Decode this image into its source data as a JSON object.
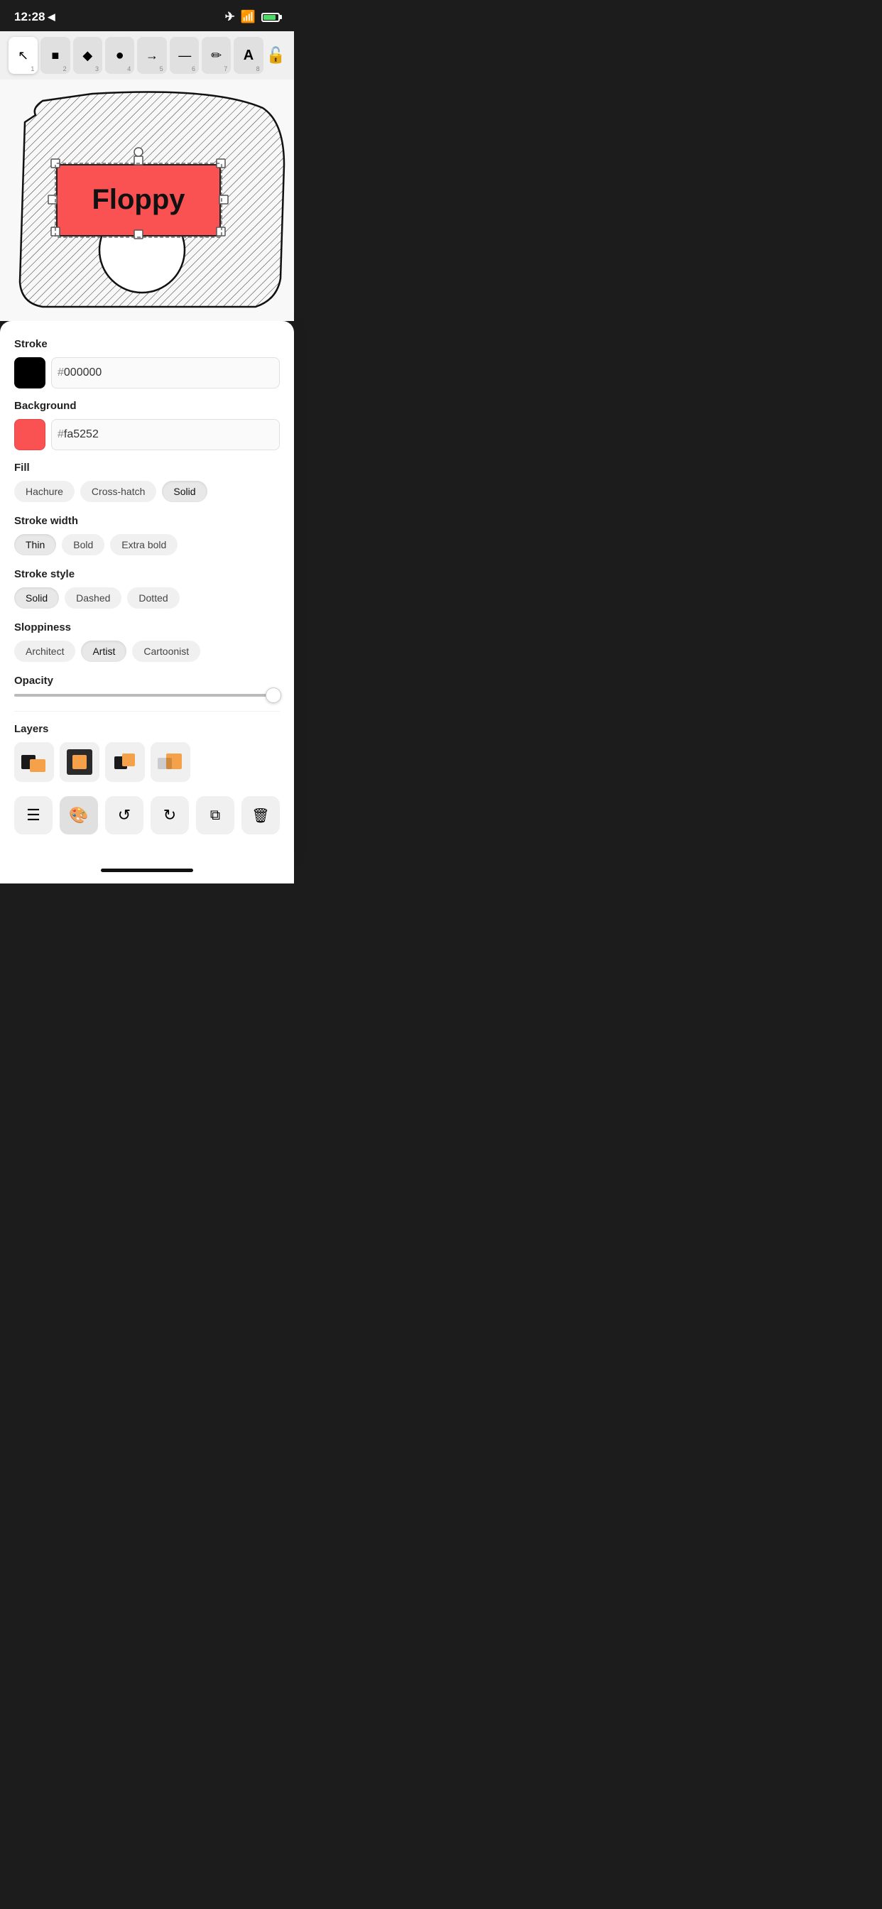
{
  "status": {
    "time": "12:28",
    "location_icon": "▶",
    "battery_level": 85
  },
  "toolbar": {
    "tools": [
      {
        "id": "select",
        "icon": "➤",
        "num": "1",
        "active": false
      },
      {
        "id": "rectangle",
        "icon": "■",
        "num": "2",
        "active": false
      },
      {
        "id": "diamond",
        "icon": "◆",
        "num": "3",
        "active": false
      },
      {
        "id": "ellipse",
        "icon": "●",
        "num": "4",
        "active": false
      },
      {
        "id": "arrow",
        "icon": "→",
        "num": "5",
        "active": false
      },
      {
        "id": "line",
        "icon": "—",
        "num": "6",
        "active": false
      },
      {
        "id": "pencil",
        "icon": "✏",
        "num": "7",
        "active": false
      },
      {
        "id": "text",
        "icon": "A",
        "num": "8",
        "active": false
      }
    ],
    "lock_icon": "🔓"
  },
  "canvas": {
    "label": "canvas-drawing"
  },
  "properties": {
    "stroke_label": "Stroke",
    "stroke_color": "#000000",
    "stroke_hex": "000000",
    "background_label": "Background",
    "bg_color": "#fa5252",
    "bg_hex": "fa5252",
    "fill_label": "Fill",
    "fill_options": [
      {
        "id": "hachure",
        "label": "Hachure",
        "active": false
      },
      {
        "id": "cross-hatch",
        "label": "Cross-hatch",
        "active": false
      },
      {
        "id": "solid",
        "label": "Solid",
        "active": true
      }
    ],
    "stroke_width_label": "Stroke width",
    "stroke_width_options": [
      {
        "id": "thin",
        "label": "Thin",
        "active": true
      },
      {
        "id": "bold",
        "label": "Bold",
        "active": false
      },
      {
        "id": "extra-bold",
        "label": "Extra bold",
        "active": false
      }
    ],
    "stroke_style_label": "Stroke style",
    "stroke_style_options": [
      {
        "id": "solid",
        "label": "Solid",
        "active": true
      },
      {
        "id": "dashed",
        "label": "Dashed",
        "active": false
      },
      {
        "id": "dotted",
        "label": "Dotted",
        "active": false
      }
    ],
    "sloppiness_label": "Sloppiness",
    "sloppiness_options": [
      {
        "id": "architect",
        "label": "Architect",
        "active": false
      },
      {
        "id": "artist",
        "label": "Artist",
        "active": true
      },
      {
        "id": "cartoonist",
        "label": "Cartoonist",
        "active": false
      }
    ],
    "opacity_label": "Opacity",
    "opacity_value": 100
  },
  "layers": {
    "label": "Layers",
    "items": [
      {
        "id": "layer-1",
        "desc": "black-orange squares"
      },
      {
        "id": "layer-2",
        "desc": "orange square on dark"
      },
      {
        "id": "layer-3",
        "desc": "overlapping squares"
      },
      {
        "id": "layer-4",
        "desc": "orange square partial"
      }
    ]
  },
  "bottom_actions": [
    {
      "id": "hamburger",
      "icon": "☰",
      "label": "menu",
      "active": false
    },
    {
      "id": "style",
      "icon": "🎨",
      "label": "style",
      "active": true
    },
    {
      "id": "undo",
      "icon": "↺",
      "label": "undo",
      "active": false
    },
    {
      "id": "redo",
      "icon": "↻",
      "label": "redo",
      "active": false
    },
    {
      "id": "duplicate",
      "icon": "⧉",
      "label": "duplicate",
      "active": false
    },
    {
      "id": "delete",
      "icon": "🗑",
      "label": "delete",
      "active": false
    }
  ]
}
